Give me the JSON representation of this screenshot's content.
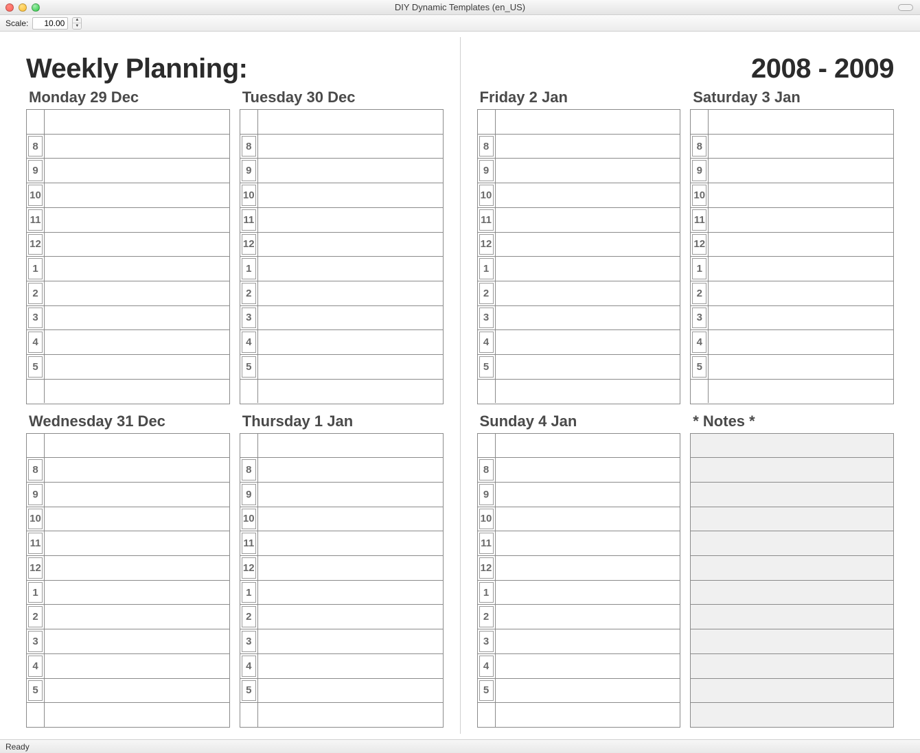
{
  "window": {
    "title": "DIY Dynamic Templates (en_US)"
  },
  "toolbar": {
    "scale_label": "Scale:",
    "scale_value": "10.00"
  },
  "planner": {
    "heading_left": "Weekly Planning:",
    "heading_right": "2008 - 2009",
    "hours": [
      "",
      "8",
      "9",
      "10",
      "11",
      "12",
      "1",
      "2",
      "3",
      "4",
      "5",
      ""
    ],
    "days_left": [
      {
        "title": "Monday 29 Dec"
      },
      {
        "title": "Tuesday 30 Dec"
      },
      {
        "title": "Wednesday 31 Dec"
      },
      {
        "title": "Thursday 1 Jan"
      }
    ],
    "days_right": [
      {
        "title": "Friday 2 Jan"
      },
      {
        "title": "Saturday 3 Jan"
      },
      {
        "title": "Sunday 4 Jan"
      }
    ],
    "notes_title": "* Notes *",
    "notes_rows": 12
  },
  "status": {
    "text": "Ready"
  }
}
